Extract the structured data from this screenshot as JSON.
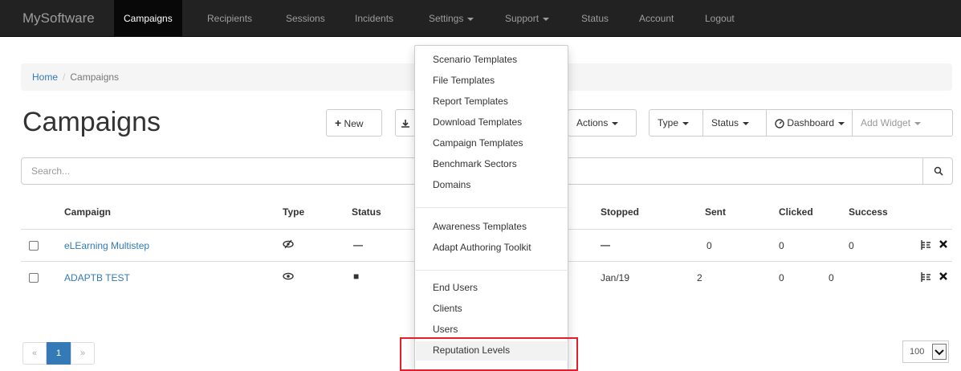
{
  "navbar": {
    "brand": "MySoftware",
    "items": [
      {
        "label": "Campaigns"
      },
      {
        "label": "Recipients"
      },
      {
        "label": "Sessions"
      },
      {
        "label": "Incidents"
      },
      {
        "label": "Settings"
      },
      {
        "label": "Support"
      },
      {
        "label": "Status"
      },
      {
        "label": "Account"
      },
      {
        "label": "Logout"
      }
    ]
  },
  "breadcrumb": {
    "home": "Home",
    "separator": "/",
    "current": "Campaigns"
  },
  "page": {
    "title": "Campaigns"
  },
  "toolbar": {
    "new_label": "New",
    "actions_label": "Actions",
    "type_label": "Type",
    "status_label": "Status",
    "dashboard_label": "Dashboard",
    "add_widget_label": "Add Widget"
  },
  "search": {
    "placeholder": "Search..."
  },
  "table": {
    "headers": [
      "Campaign",
      "Type",
      "Status",
      "Stopped",
      "Sent",
      "Clicked",
      "Success"
    ],
    "rows": [
      {
        "campaign": "eLEarning Multistep",
        "status": "—",
        "stopped": "—",
        "sent": "0",
        "clicked": "0",
        "success": "0"
      },
      {
        "campaign": "ADAPTB TEST",
        "status": "■",
        "stopped": "Jan/19",
        "sent": "2",
        "clicked": "0",
        "success": "0"
      }
    ]
  },
  "pagination": {
    "current": "1",
    "prev": "«",
    "next": "»",
    "page_size": "100"
  },
  "settings_menu": {
    "items_group1": [
      "Scenario Templates",
      "File Templates",
      "Report Templates",
      "Download Templates",
      "Campaign Templates",
      "Benchmark Sectors",
      "Domains"
    ],
    "items_group2": [
      "Awareness Templates",
      "Adapt Authoring Toolkit"
    ],
    "items_group3": [
      "End Users",
      "Clients",
      "Users",
      "Reputation Levels"
    ]
  },
  "colors": {
    "navbar_bg": "#222222",
    "link": "#337ab7",
    "highlight": "#e41e2b"
  }
}
